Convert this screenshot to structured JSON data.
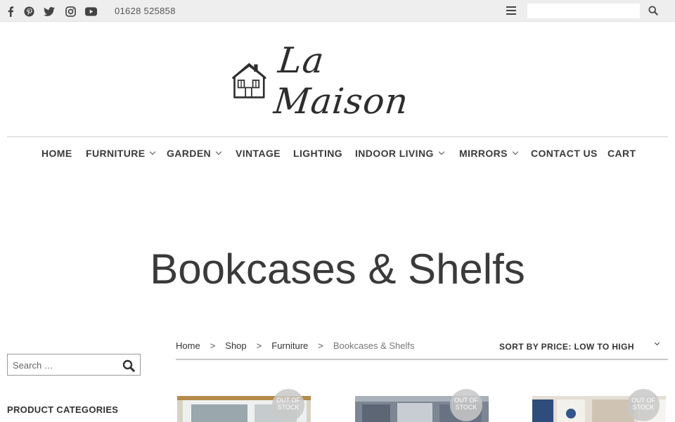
{
  "topbar": {
    "social": [
      "facebook-icon",
      "pinterest-icon",
      "twitter-icon",
      "instagram-icon",
      "youtube-icon"
    ],
    "phone": "01628 525858",
    "search_placeholder": ""
  },
  "logo": {
    "text": "La Maison"
  },
  "nav": {
    "items": [
      {
        "label": "HOME",
        "dropdown": false
      },
      {
        "label": "FURNITURE",
        "dropdown": true
      },
      {
        "label": "GARDEN",
        "dropdown": true
      },
      {
        "label": "VINTAGE",
        "dropdown": false
      },
      {
        "label": "LIGHTING",
        "dropdown": false
      },
      {
        "label": "INDOOR LIVING",
        "dropdown": true
      },
      {
        "label": "MIRRORS",
        "dropdown": true
      },
      {
        "label": "CONTACT US",
        "dropdown": false
      },
      {
        "label": "CART",
        "dropdown": false
      }
    ]
  },
  "page": {
    "title": "Bookcases & Shelfs"
  },
  "sidebar": {
    "search_placeholder": "Search …",
    "categories_heading": "PRODUCT CATEGORIES"
  },
  "breadcrumb": {
    "items": [
      "Home",
      "Shop",
      "Furniture",
      "Bookcases & Shelfs"
    ],
    "separator": ">"
  },
  "sort": {
    "label": "SORT BY PRICE: LOW TO HIGH"
  },
  "products": [
    {
      "badge": "OUT OF STOCK"
    },
    {
      "badge": "OUT OF STOCK"
    },
    {
      "badge": "OUT OF STOCK"
    }
  ],
  "colors": {
    "topbar": "#eeeeee",
    "text": "#3a3a3a",
    "badge": "#c8c8c8"
  }
}
